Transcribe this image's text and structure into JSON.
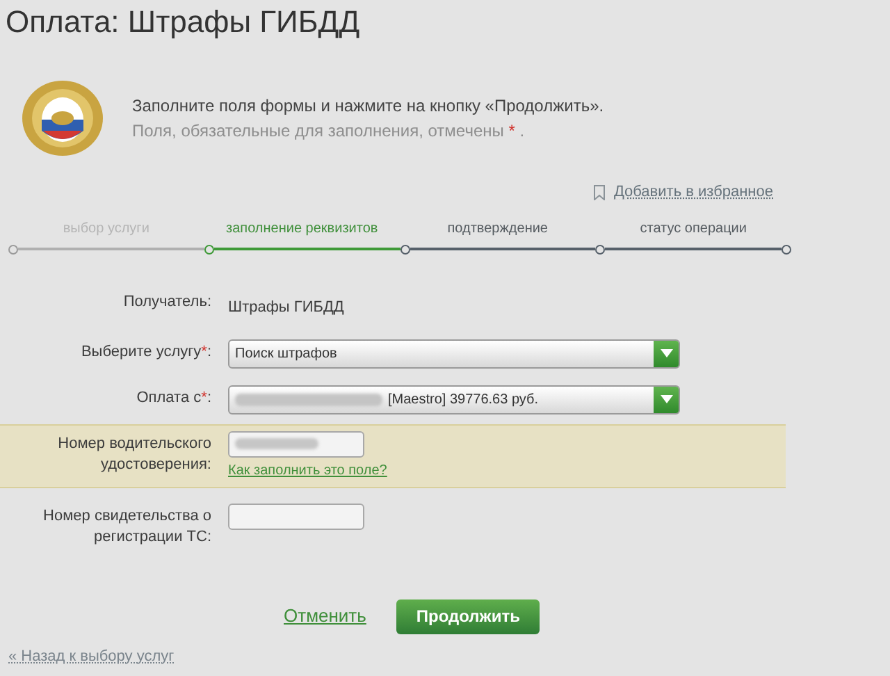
{
  "title": "Оплата: Штрафы ГИБДД",
  "intro": {
    "text": "Заполните поля формы и нажмите на кнопку «Продолжить».",
    "hint_before": "Поля, обязательные для заполнения, отмечены",
    "hint_mark": "*",
    "hint_after": "."
  },
  "favorite_link": "Добавить в избранное",
  "steps": [
    {
      "label": "выбор услуги",
      "completed": true,
      "selected": false
    },
    {
      "label": "заполнение реквизитов",
      "completed": false,
      "selected": true
    },
    {
      "label": "подтверждение",
      "completed": false,
      "selected": false
    },
    {
      "label": "статус операции",
      "completed": false,
      "selected": false
    }
  ],
  "fields": [
    {
      "kind": "text",
      "label": "Получатель",
      "colon": ":",
      "value": "Штрафы ГИБДД",
      "highlighted": false
    },
    {
      "kind": "select",
      "label": "Выберите услугу",
      "required_mark": "*",
      "colon": ":",
      "value": "Поиск штрафов",
      "blurred_prefix": false,
      "highlighted": false
    },
    {
      "kind": "select",
      "label": "Оплата с",
      "required_mark": "*",
      "colon": ":",
      "value": "[Maestro] 39776.63 руб.",
      "blurred_prefix": true,
      "highlighted": false
    },
    {
      "kind": "input",
      "label": "Номер водительского удостоверения:",
      "blurred_value": true,
      "highlighted": true,
      "help_link": "Как заполнить это поле?"
    },
    {
      "kind": "input",
      "label": "Номер свидетельства о регистрации ТС:",
      "blurred_value": false,
      "highlighted": false
    }
  ],
  "buttons": {
    "cancel": "Отменить",
    "continue": "Продолжить"
  },
  "back_link": "« Назад к выбору услуг"
}
